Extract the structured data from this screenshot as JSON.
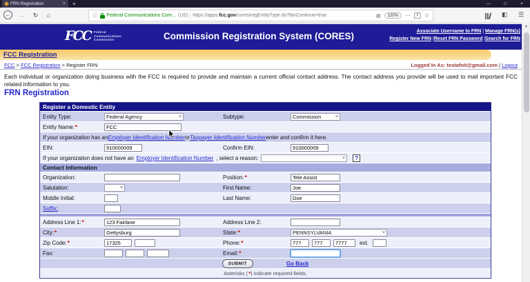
{
  "colors": {
    "header_navy": "#1e1c96",
    "gold": "#f3c561",
    "link_blue": "#2a2acc",
    "required_red": "#cc0000",
    "lock_green": "#058b00"
  },
  "icons": {
    "back": "←",
    "forward": "→",
    "reload": "↻",
    "home": "⌂",
    "info": "ⓘ",
    "ellipsis": "⋯",
    "pocket": "∨",
    "star": "☆",
    "reader": "▤",
    "sidebar": "◧",
    "menu": "☰",
    "minimize": "—",
    "maximize": "□",
    "close": "×",
    "tab_close": "×",
    "new_tab": "+",
    "chevron": "∨",
    "up_arrow": "▲",
    "help": "?"
  },
  "browser": {
    "tab_title": "FRN Registration",
    "identity": "Federal Communications Com...",
    "country": "(US)",
    "url_prefix": "https://apps.",
    "url_domain": "fcc.gov",
    "url_path": "/cores/regEntityType.do?btnContinue=true",
    "zoom_level": "120%"
  },
  "header": {
    "logo": "FCC",
    "logo_caption": "Federal\nCommunications\nCommission",
    "title": "Commission Registration System (CORES)",
    "nav1": [
      "Associate Username to FRN",
      "Manage FRN(s)"
    ],
    "nav1_sep": " | ",
    "nav2": [
      "Register New FRN",
      "Reset FRN Password",
      "Search for FRN"
    ],
    "nav2_sep": " |",
    "banner": "FCC Registration"
  },
  "breadcrumb": {
    "items": [
      "FCC",
      "FCC Registration",
      "Register FRN"
    ],
    "sep": " > "
  },
  "session": {
    "label": "Logged In As:",
    "user": " testafoit@gmail.com",
    "sep": " | ",
    "logout": "Logout"
  },
  "intro": "Each individual or organization doing business with the FCC is required to provide and maintain a current official contact address. The contact address you provide will be used to mail important FCC related information to you.",
  "page_title": "FRN Registration",
  "form": {
    "asterisk": "*",
    "section_title": "Register a Domestic Entity",
    "entity_type_label": "Entity Type:",
    "entity_type_value": "Federal Agency",
    "subtype_label": "Subtype:",
    "subtype_value": "Commission",
    "entity_name_label": "Entity Name:",
    "entity_name_value": "FCC",
    "ein_note_1": "If your organization has an ",
    "ein_note_link1": "Employer Identification Number",
    "ein_note_2": " or ",
    "ein_note_link2": "Taxpayer Identification Number",
    "ein_note_3": " enter and confirm it here.",
    "ein_label": "EIN:",
    "ein_value": "910000009",
    "confirm_ein_label": "Confirm EIN:",
    "confirm_ein_value": "910000009",
    "reason_1": "If your organization does not have an ",
    "reason_link": "Employer Identification Number",
    "reason_2": ", select a reason:",
    "contact_title": "Contact Information",
    "organization_label": "Organization:",
    "position_label": "Position:",
    "position_value": "Tele Assist",
    "salutation_label": "Salutation:",
    "first_name_label": "First Name:",
    "first_name_value": "Joe",
    "middle_initial_label": "Middle Initial:",
    "last_name_label": "Last Name:",
    "last_name_value": "Doe",
    "suffix_label": "Suffix:",
    "address1_label": "Address Line 1:",
    "address1_value": "123 Fairlane",
    "address2_label": "Address Line 2:",
    "city_label": "City:",
    "city_value": "Gettysburg",
    "state_label": "State:",
    "state_value": "PENNSYLVANIA",
    "zip_label": "Zip Code:",
    "zip_value": "17325",
    "phone_label": "Phone:",
    "phone_area": "777",
    "phone_prefix": "777",
    "phone_line": "7777",
    "ext_label": "ext.",
    "fax_label": "Fax:",
    "email_label": "Email:",
    "submit_label": "SUBMIT",
    "go_back_label": "Go Back",
    "footnote_1": "Asterisks (",
    "footnote_2": ") indicate required fields."
  }
}
